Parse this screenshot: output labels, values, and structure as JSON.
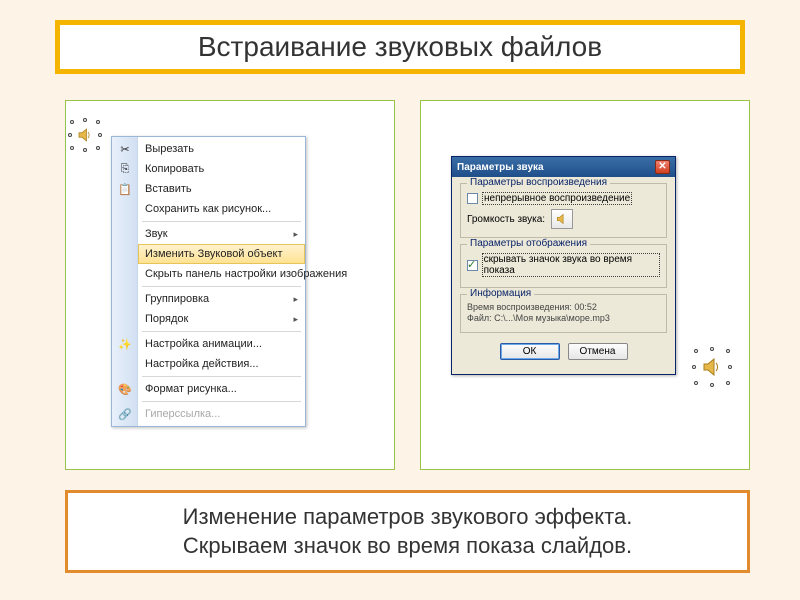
{
  "title": "Встраивание звуковых файлов",
  "caption": {
    "line1": "Изменение параметров звукового эффекта.",
    "line2": "Скрываем значок во время показа слайдов."
  },
  "context_menu": {
    "items": [
      {
        "label": "Вырезать",
        "icon": "✂"
      },
      {
        "label": "Копировать",
        "icon": "⎘"
      },
      {
        "label": "Вставить",
        "icon": "📋"
      },
      {
        "label": "Сохранить как рисунок...",
        "icon": ""
      }
    ],
    "items2": [
      {
        "label": "Звук",
        "submenu": true
      },
      {
        "label": "Изменить Звуковой объект",
        "highlight": true
      },
      {
        "label": "Скрыть панель настройки изображения"
      }
    ],
    "items3": [
      {
        "label": "Группировка",
        "submenu": true
      },
      {
        "label": "Порядок",
        "submenu": true
      }
    ],
    "items4": [
      {
        "label": "Настройка анимации...",
        "icon": "✨"
      },
      {
        "label": "Настройка действия..."
      }
    ],
    "items5": [
      {
        "label": "Формат рисунка...",
        "icon": "🎨"
      }
    ],
    "items6": [
      {
        "label": "Гиперссылка...",
        "icon": "🔗",
        "disabled": true
      }
    ]
  },
  "dialog": {
    "title": "Параметры звука",
    "group1": {
      "legend": "Параметры воспроизведения",
      "checkbox": "непрерывное воспроизведение",
      "vol_label": "Громкость звука:"
    },
    "group2": {
      "legend": "Параметры отображения",
      "checkbox": "скрывать значок звука во время показа"
    },
    "group3": {
      "legend": "Информация",
      "line1": "Время воспроизведения:   00:52",
      "line2": "Файл:   C:\\...\\Моя музыка\\море.mp3"
    },
    "ok": "ОК",
    "cancel": "Отмена"
  }
}
